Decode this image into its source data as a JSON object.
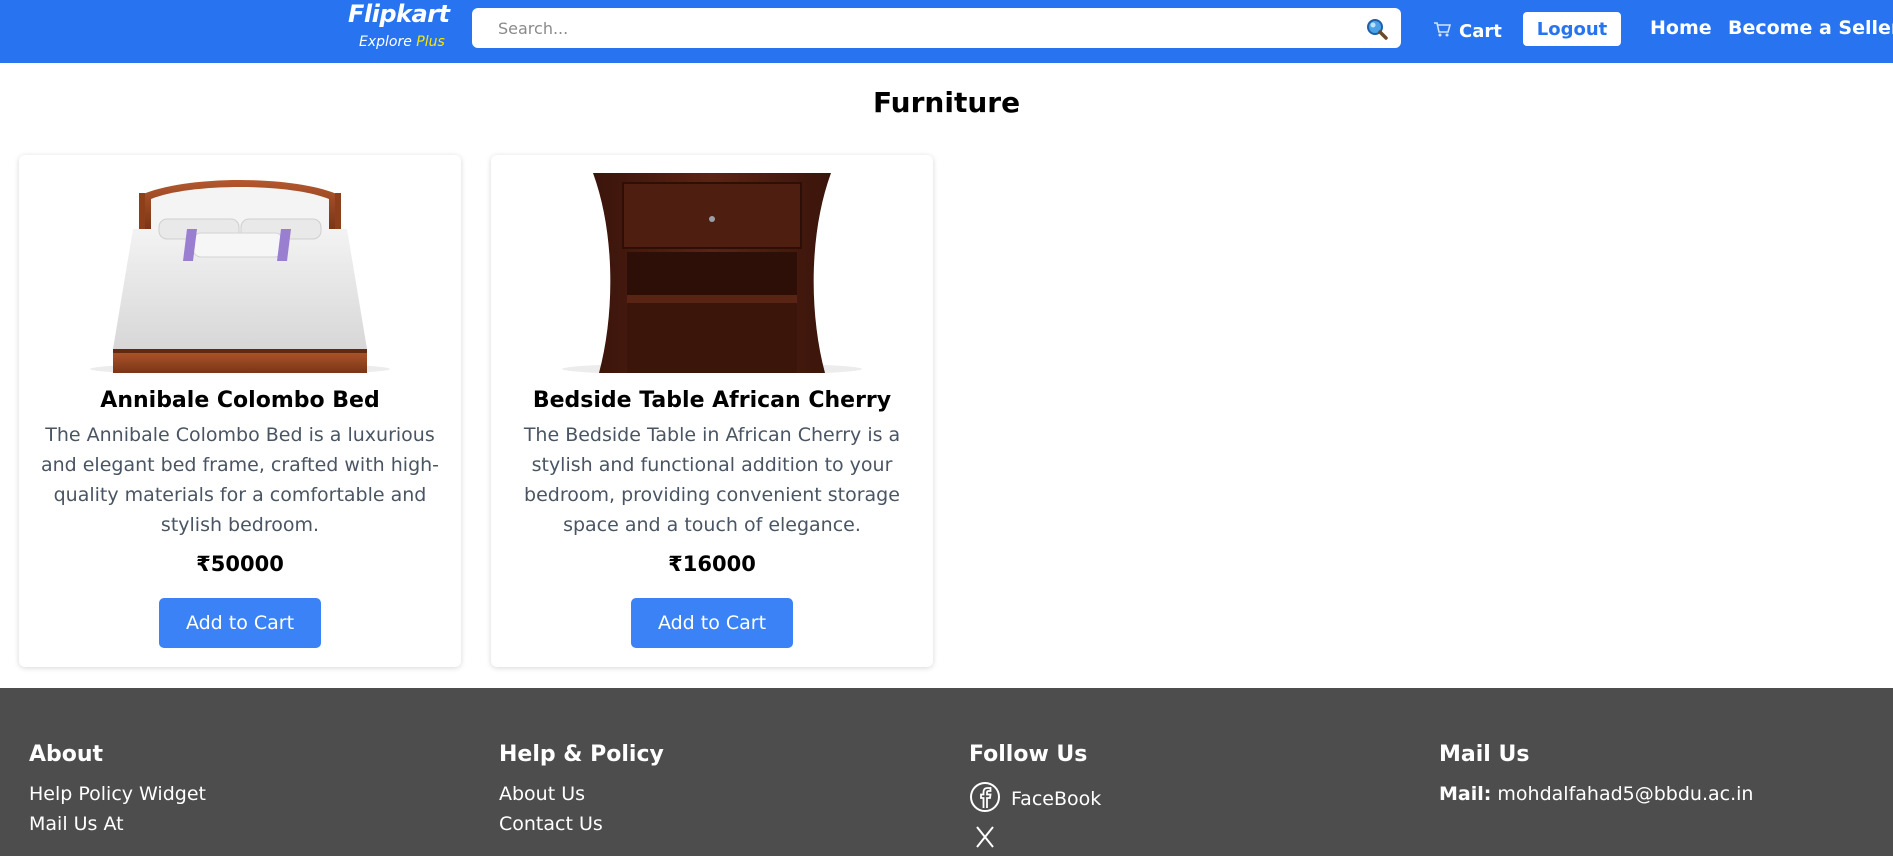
{
  "header": {
    "logo": {
      "name": "Flipkart",
      "tagline_prefix": "Explore",
      "tagline_plus": "Plus"
    },
    "search": {
      "placeholder": "Search...",
      "value": ""
    },
    "nav": {
      "cart_label": "Cart",
      "logout_label": "Logout",
      "home_label": "Home",
      "seller_label": "Become a Seller"
    },
    "colors": {
      "brand": "#2874f0",
      "plus": "#ffe500"
    }
  },
  "page": {
    "title": "Furniture"
  },
  "products": [
    {
      "title": "Annibale Colombo Bed",
      "description": "The Annibale Colombo Bed is a luxurious and elegant bed frame, crafted with high-quality materials for a comfortable and stylish bedroom.",
      "price": "₹50000",
      "button_label": "Add to Cart"
    },
    {
      "title": "Bedside Table African Cherry",
      "description": "The Bedside Table in African Cherry is a stylish and functional addition to your bedroom, providing convenient storage space and a touch of elegance.",
      "price": "₹16000",
      "button_label": "Add to Cart"
    }
  ],
  "footer": {
    "about": {
      "heading": "About",
      "links": [
        "Help Policy Widget",
        "Mail Us At"
      ]
    },
    "help": {
      "heading": "Help & Policy",
      "links": [
        "About Us",
        "Contact Us"
      ]
    },
    "follow": {
      "heading": "Follow Us",
      "facebook_label": "FaceBook"
    },
    "mail": {
      "heading": "Mail Us",
      "label": "Mail:",
      "address": "mohdalfahad5@bbdu.ac.in"
    },
    "background": "#4d4d4d"
  },
  "icons": [
    "search-icon",
    "cart-icon",
    "facebook-icon",
    "x-icon"
  ]
}
